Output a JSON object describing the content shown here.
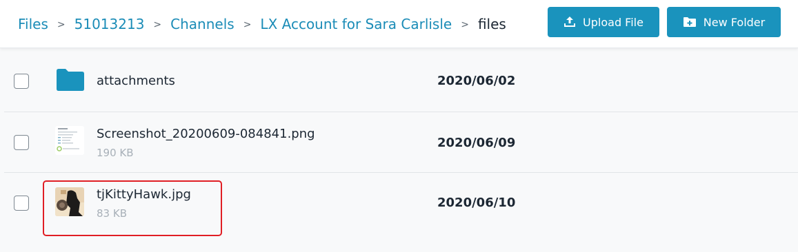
{
  "breadcrumb": {
    "items": [
      "Files",
      "51013213",
      "Channels",
      "LX Account for Sara Carlisle"
    ],
    "current": "files",
    "separator": ">"
  },
  "toolbar": {
    "upload_label": "Upload File",
    "upload_icon": "upload-icon",
    "new_folder_label": "New Folder",
    "new_folder_icon": "folder-plus-icon"
  },
  "colors": {
    "accent": "#1a93bd",
    "link": "#1b8cb7",
    "highlight": "#e01e24"
  },
  "files": [
    {
      "name": "attachments",
      "type": "folder",
      "size": "",
      "date": "2020/06/02",
      "icon": "folder-icon"
    },
    {
      "name": "Screenshot_20200609-084841.png",
      "type": "image",
      "size": "190 KB",
      "date": "2020/06/09",
      "icon": "screenshot-thumbnail"
    },
    {
      "name": "tjKittyHawk.jpg",
      "type": "image",
      "size": "83 KB",
      "date": "2020/06/10",
      "icon": "photo-thumbnail",
      "highlighted": true
    }
  ]
}
